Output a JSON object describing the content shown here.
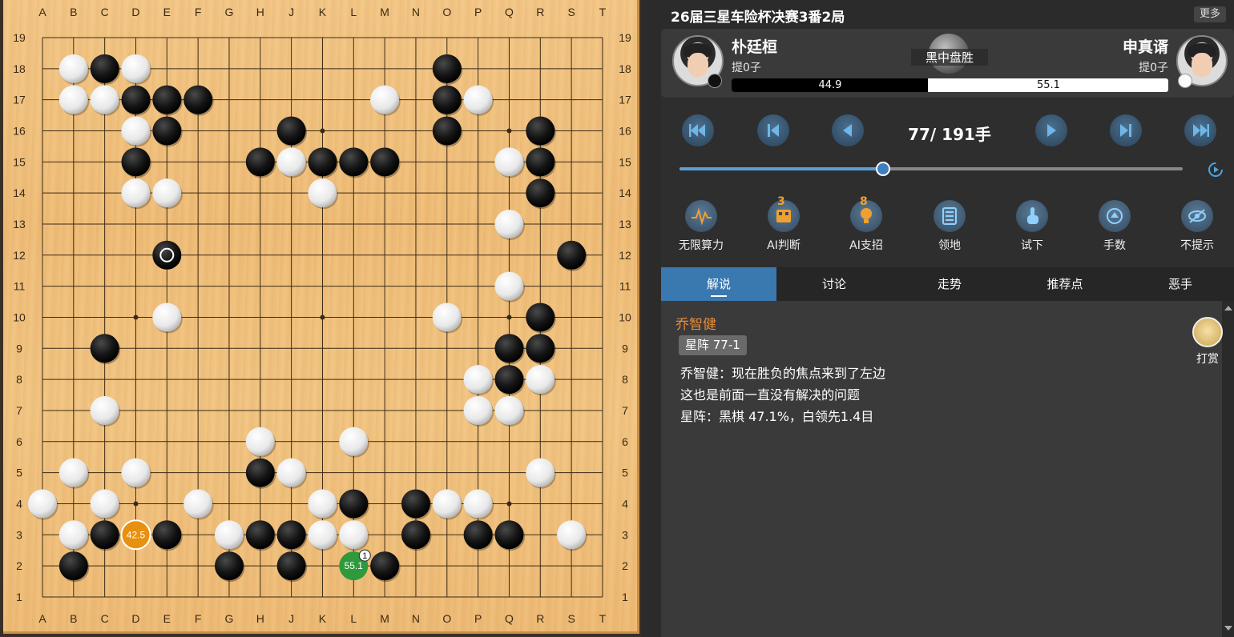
{
  "board": {
    "columns": [
      "A",
      "B",
      "C",
      "D",
      "E",
      "F",
      "G",
      "H",
      "J",
      "K",
      "L",
      "M",
      "N",
      "O",
      "P",
      "Q",
      "R",
      "S",
      "T"
    ],
    "rows": [
      "19",
      "18",
      "17",
      "16",
      "15",
      "14",
      "13",
      "12",
      "11",
      "10",
      "9",
      "8",
      "7",
      "6",
      "5",
      "4",
      "3",
      "2",
      "1"
    ],
    "star_points": [
      "D16",
      "K16",
      "Q16",
      "D10",
      "K10",
      "Q10",
      "D4",
      "K4",
      "Q4"
    ],
    "black_stones": [
      "C18",
      "O18",
      "D17",
      "E17",
      "F17",
      "O17",
      "E16",
      "J16",
      "O16",
      "R16",
      "D15",
      "H15",
      "K15",
      "L15",
      "M15",
      "R15",
      "R14",
      "S12",
      "R10",
      "C9",
      "Q9",
      "R9",
      "Q8",
      "H5",
      "L4",
      "N4",
      "C3",
      "E3",
      "H3",
      "J3",
      "N3",
      "P3",
      "Q3",
      "B2",
      "G2",
      "J2",
      "M2"
    ],
    "white_stones": [
      "B18",
      "D18",
      "B17",
      "C17",
      "M17",
      "P17",
      "D16",
      "Q15",
      "J15",
      "D14",
      "E14",
      "K14",
      "Q13",
      "Q11",
      "E10",
      "O10",
      "P8",
      "R8",
      "C7",
      "P7",
      "Q7",
      "H6",
      "L6",
      "B5",
      "D5",
      "J5",
      "R5",
      "A4",
      "C4",
      "F4",
      "K4",
      "O4",
      "P4",
      "B3",
      "G3",
      "K3",
      "L3",
      "S3"
    ],
    "last_move": "E12",
    "marker_candidate": {
      "point": "D3",
      "label": "42.5"
    },
    "marker_best": {
      "point": "L2",
      "label": "55.1",
      "rank": "1"
    }
  },
  "header": {
    "title": "26届三星车险杯决赛3番2局",
    "more_label": "更多"
  },
  "players": {
    "black": {
      "name": "朴廷桓",
      "captures": "提0子"
    },
    "white": {
      "name": "申真谞",
      "captures": "提0子"
    },
    "result": "黑中盘胜",
    "win_black": "44.9",
    "win_white": "55.1",
    "win_black_fraction": 0.449
  },
  "navigation": {
    "move_counter": "77/ 191手",
    "progress": 0.403
  },
  "tools": [
    {
      "label": "无限算力",
      "badge": ""
    },
    {
      "label": "AI判断",
      "badge": "3"
    },
    {
      "label": "AI支招",
      "badge": "8"
    },
    {
      "label": "领地",
      "badge": ""
    },
    {
      "label": "试下",
      "badge": ""
    },
    {
      "label": "手数",
      "badge": ""
    },
    {
      "label": "不提示",
      "badge": ""
    }
  ],
  "tabs": [
    "解说",
    "讨论",
    "走势",
    "推荐点",
    "恶手"
  ],
  "comment": {
    "author": "乔智健",
    "tag": "星阵 77-1",
    "lines": [
      "乔智健：现在胜负的焦点来到了左边",
      "这也是前面一直没有解决的问题",
      "星阵：黑棋 47.1%，白领先1.4目"
    ]
  },
  "reward_label": "打赏",
  "colors": {
    "accent": "#3a78b0",
    "commentator": "#e98c3a",
    "best_move": "#2e9a3c",
    "candidate": "#e8900f",
    "board": "#f0c07c"
  }
}
